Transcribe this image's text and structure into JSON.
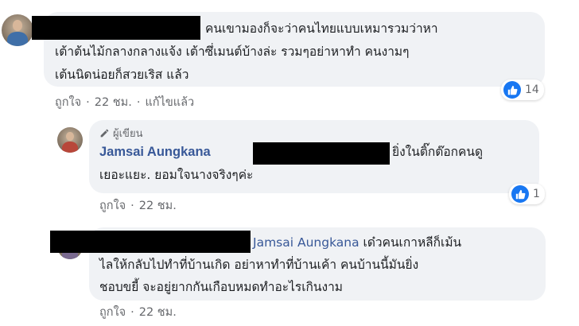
{
  "comment1": {
    "text_lines": [
      "คนเขามองก็จะว่าคนไทยแบบเหมารวมว่าหา",
      "เต้าต้นไม้กลางกลางแจ้ง เต้าซึ่เมนต์บ้างล่ะ รวมๆอย่าหาทำ คนงามๆ",
      "เต้นนิดน่อยก็สวยเริส แล้ว"
    ],
    "reaction_count": "14",
    "actions": {
      "like": "ถูกใจ",
      "time": "22 ชม.",
      "edited": "แก้ไขแล้ว"
    }
  },
  "reply1": {
    "author_tag": "ผู้เขียน",
    "author": "Jamsai Aungkana",
    "text_line1": "ยิ่งในติ๊กต๊อกคนดู",
    "text_line2": "เยอะแยะ. ยอมใจนางจริงๆค่ะ",
    "reaction_count": "1",
    "actions": {
      "like": "ถูกใจ",
      "time": "22 ชม."
    }
  },
  "reply2": {
    "mention": "Jamsai Aungkana",
    "text_line1": " เด๋วคนเกาหลีก็เม้น",
    "text_line2": "ไลให้กลับไปทำที่บ้านเกิด อย่าหาทำที่บ้านเค้า คนบ้านนี้มันยิ่ง",
    "text_line3": "ชอบขยี้ จะอยู่ยากกันเกือบหมดทำอะไรเกินงาม",
    "actions": {
      "like": "ถูกใจ",
      "time": "22 ชม."
    }
  },
  "colors": {
    "bubble": "#f0f2f5",
    "link": "#385898",
    "meta": "#65676b",
    "like_blue": "#1877f2"
  },
  "icons": [
    "like-icon",
    "pen-icon"
  ]
}
